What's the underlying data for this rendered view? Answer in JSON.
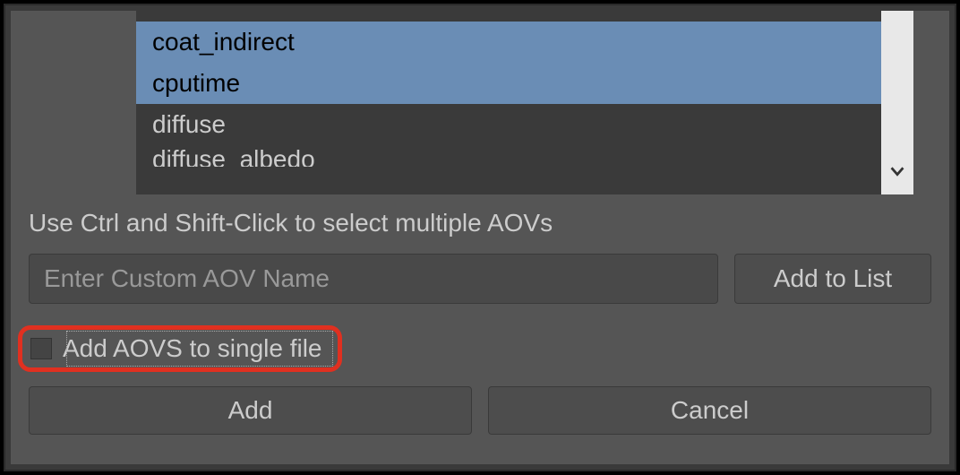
{
  "aov_list": {
    "items": [
      {
        "label": "",
        "selected": false,
        "partial": "top"
      },
      {
        "label": "coat_indirect",
        "selected": true
      },
      {
        "label": "cputime",
        "selected": true
      },
      {
        "label": "diffuse",
        "selected": false
      },
      {
        "label": "diffuse_albedo",
        "selected": false,
        "partial": "bottom"
      }
    ]
  },
  "instruction_text": "Use Ctrl and Shift-Click to select multiple AOVs",
  "custom_aov": {
    "placeholder": "Enter Custom AOV Name",
    "value": ""
  },
  "buttons": {
    "add_to_list": "Add to List",
    "add": "Add",
    "cancel": "Cancel"
  },
  "checkbox": {
    "label": "Add AOVS to single file",
    "checked": false
  }
}
